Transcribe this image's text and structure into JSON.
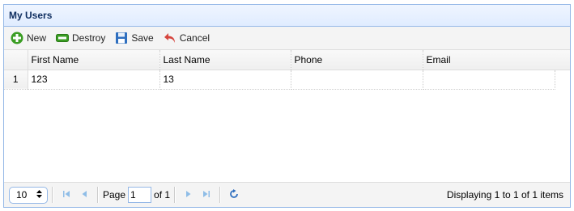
{
  "panel": {
    "title": "My Users"
  },
  "toolbar": {
    "new_label": "New",
    "destroy_label": "Destroy",
    "save_label": "Save",
    "cancel_label": "Cancel",
    "icons": {
      "new": "plus-icon",
      "destroy": "minus-icon",
      "save": "floppy-disk-icon",
      "cancel": "undo-arrow-icon"
    }
  },
  "grid": {
    "columns": [
      "First Name",
      "Last Name",
      "Phone",
      "Email"
    ],
    "rows": [
      {
        "rownum": "1",
        "first_name": "123",
        "last_name": "13",
        "phone": "",
        "email": ""
      }
    ]
  },
  "pager": {
    "page_size": "10",
    "page_label": "Page",
    "page_value": "1",
    "of_label": "of 1",
    "info": "Displaying 1 to 1 of 1 items",
    "accent_color": "#95b8e7"
  }
}
